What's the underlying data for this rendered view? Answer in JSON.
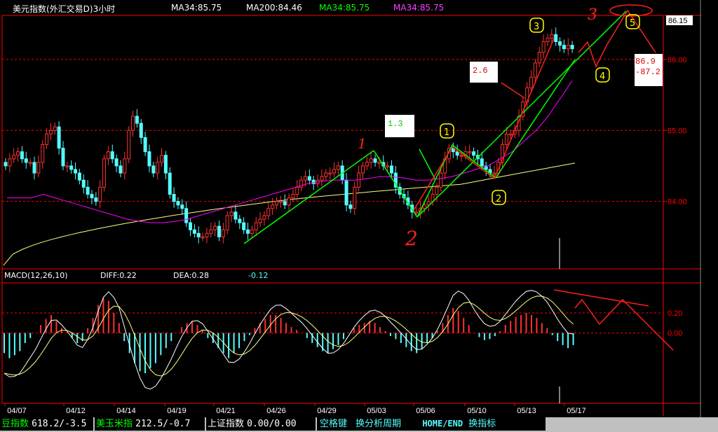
{
  "header": {
    "title": "美元指数(外汇交易D)3小时",
    "ma34": "MA34:85.75",
    "ma200": "MA200:84.46",
    "ma34_green": "MA34:85.75",
    "ma34_magenta": "MA34:85.75"
  },
  "price_badge": "86.15",
  "macd_header": {
    "name": "MACD(12,26,10)",
    "diff": "DIFF:0.22",
    "dea": "DEA:0.28",
    "macd": "-0.12"
  },
  "annotations": {
    "box_1_3": "1.3",
    "box_2_6": "2.6",
    "target_high": "86.9",
    "target_low": "-87.2",
    "wave_1": "1",
    "wave_2": "2",
    "wave_3": "3",
    "circle_1": "1",
    "circle_2": "2",
    "circle_3": "3",
    "circle_4": "4",
    "circle_5": "5"
  },
  "statusbar": {
    "item1_label": "豆指数",
    "item1_value": "618.2/-3.5",
    "item2_label": "美玉米指",
    "item2_value": "212.5/-0.7",
    "item3_label": "上证指数",
    "item3_value": "0.00/0.00",
    "hint1": "空格键",
    "hint2": "换分析周期",
    "hint3": "HOME/END",
    "hint4": "换指标"
  },
  "colors": {
    "background": "#000000",
    "up_candle": "#ff3232",
    "down_candle": "#54ffff",
    "ma_short": "#ff00ff",
    "ma_long": "#ffff80",
    "axis_red": "#ff0000",
    "trend_green": "#00ff00",
    "annotation_red": "#ff2020",
    "annotation_yellow": "#ffff00"
  },
  "chart_data": {
    "type": "candlestick",
    "x_tick_labels": [
      "04/07",
      "04/12",
      "04/14",
      "04/19",
      "04/21",
      "04/26",
      "04/29",
      "05/03",
      "05/06",
      "05/10",
      "05/13",
      "05/17"
    ],
    "price_axis": {
      "ticks": [
        84.0,
        85.0,
        86.0
      ],
      "ylim": [
        83.05,
        86.62
      ],
      "tick_labels": [
        "84.00",
        "85.00",
        "86.00"
      ]
    },
    "close_series": [
      84.5,
      84.6,
      84.65,
      84.7,
      84.6,
      84.55,
      84.55,
      84.4,
      84.55,
      84.8,
      84.95,
      85.0,
      85.05,
      84.75,
      84.5,
      84.5,
      84.45,
      84.4,
      84.3,
      84.2,
      84.1,
      84.05,
      84.0,
      84.2,
      84.6,
      84.7,
      84.6,
      84.5,
      84.4,
      84.6,
      85.0,
      85.2,
      85.1,
      84.9,
      84.7,
      84.5,
      84.4,
      84.55,
      84.65,
      84.4,
      84.1,
      84.0,
      83.95,
      83.9,
      83.7,
      83.6,
      83.55,
      83.5,
      83.5,
      83.55,
      83.6,
      83.65,
      83.5,
      83.6,
      83.8,
      83.85,
      83.75,
      83.7,
      83.6,
      83.55,
      83.6,
      83.7,
      83.75,
      83.8,
      83.9,
      83.95,
      84.0,
      84.0,
      83.95,
      84.05,
      84.1,
      84.2,
      84.3,
      84.35,
      84.3,
      84.25,
      84.3,
      84.35,
      84.4,
      84.4,
      84.45,
      84.5,
      84.3,
      83.95,
      83.9,
      84.2,
      84.4,
      84.5,
      84.55,
      84.6,
      84.55,
      84.55,
      84.5,
      84.5,
      84.4,
      84.2,
      84.1,
      84.05,
      83.95,
      83.85,
      83.85,
      83.9,
      83.95,
      84.0,
      84.1,
      84.2,
      84.4,
      84.6,
      84.75,
      84.7,
      84.65,
      84.65,
      84.7,
      84.7,
      84.65,
      84.6,
      84.5,
      84.45,
      84.4,
      84.4,
      84.55,
      84.8,
      84.95,
      84.95,
      85.0,
      85.2,
      85.4,
      85.6,
      85.75,
      85.95,
      86.1,
      86.25,
      86.3,
      86.35,
      86.25,
      86.2,
      86.15,
      86.2,
      86.15
    ],
    "ma34_series_start": 20,
    "ma34_approx": [
      84.05,
      84.05,
      84.05,
      84.1,
      84.05,
      84.0,
      83.95,
      83.9,
      83.85,
      83.8,
      83.75,
      83.72,
      83.7,
      83.7,
      83.72,
      83.75,
      83.8,
      83.85,
      83.9,
      83.95,
      84.0,
      84.05,
      84.1,
      84.15,
      84.2,
      84.25,
      84.28,
      84.3,
      84.3,
      84.3,
      84.32,
      84.35,
      84.35,
      84.33,
      84.3,
      84.3,
      84.32,
      84.35,
      84.4,
      84.45,
      84.5,
      84.6,
      84.7,
      84.85,
      85.0,
      85.2,
      85.45,
      85.7
    ],
    "ma200_approx_endpoints": [
      83.1,
      84.45
    ],
    "macd": {
      "ylim": [
        -0.7,
        0.5
      ],
      "tick_labels": [
        "0.20",
        "0.00"
      ],
      "diff": 0.22,
      "dea": 0.28,
      "macd": -0.12,
      "histogram": [
        -0.2,
        -0.25,
        -0.22,
        -0.18,
        -0.1,
        -0.05,
        0,
        0.08,
        0.14,
        0.18,
        0.12,
        0.05,
        0,
        -0.05,
        -0.1,
        -0.08,
        0.05,
        0.15,
        0.28,
        0.35,
        0.32,
        0.2,
        0.1,
        -0.08,
        -0.2,
        -0.3,
        -0.38,
        -0.4,
        -0.35,
        -0.3,
        -0.22,
        -0.15,
        -0.08,
        0,
        0.06,
        0.1,
        0.12,
        0.08,
        0.03,
        -0.05,
        -0.1,
        -0.15,
        -0.2,
        -0.25,
        -0.2,
        -0.15,
        -0.08,
        -0.02,
        0.05,
        0.1,
        0.14,
        0.18,
        0.18,
        0.15,
        0.1,
        0.06,
        0.03,
        0,
        -0.05,
        -0.1,
        -0.14,
        -0.18,
        -0.2,
        -0.16,
        -0.12,
        -0.06,
        0,
        0.05,
        0.08,
        0.1,
        0.12,
        0.1,
        0.06,
        0.02,
        -0.03,
        -0.06,
        -0.1,
        -0.14,
        -0.18,
        -0.2,
        -0.16,
        -0.1,
        -0.05,
        0.02,
        0.1,
        0.18,
        0.25,
        0.22,
        0.15,
        0.08,
        0,
        -0.04,
        -0.07,
        -0.06,
        -0.03,
        0.02,
        0.08,
        0.12,
        0.16,
        0.18,
        0.2,
        0.18,
        0.15,
        0.1,
        0.05,
        -0.02,
        -0.08,
        -0.12,
        -0.15,
        -0.12
      ]
    }
  }
}
